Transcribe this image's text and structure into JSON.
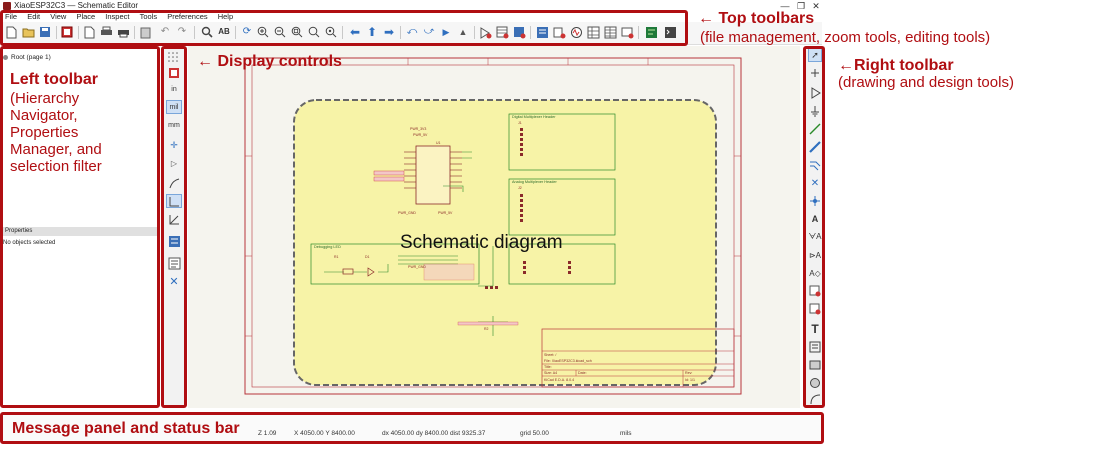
{
  "window": {
    "title": "XiaoESP32C3 — Schematic Editor",
    "controls": [
      "—",
      "❐",
      "✕"
    ]
  },
  "menu": [
    "File",
    "Edit",
    "View",
    "Place",
    "Inspect",
    "Tools",
    "Preferences",
    "Help"
  ],
  "hierarchy": {
    "root_label": "Root (page 1)"
  },
  "properties": {
    "header": "Properties",
    "empty_message": "No objects selected"
  },
  "display_controls": {
    "inch_label": "in",
    "mil_label": "mil",
    "mm_label": "mm"
  },
  "status": {
    "zoom": "Z 1.09",
    "coords": "X 4050.00  Y 8400.00",
    "delta": "dx 4050.00  dy 8400.00  dist 9325.37",
    "grid": "grid 50.00",
    "units": "mils"
  },
  "schematic": {
    "label": "Schematic diagram",
    "block_titles": [
      "Digital Multiplexer Header",
      "Analog Multiplexer Header",
      "Debugging LED"
    ],
    "title_block": {
      "sheet": "Sheet: /",
      "file": "File: XiaoESP32C3.kicad_sch",
      "title": "Title:",
      "size": "Size: A4",
      "date": "Date:",
      "rev": "Rev:",
      "kicad": "KiCad E.D.A. 8.0.4",
      "id": "Id: 1/1"
    }
  },
  "annotations": {
    "top_toolbars_title": "← Top toolbars",
    "top_toolbars_desc": "(file management, zoom tools, editing tools)",
    "display_controls": "← Display controls",
    "left_toolbar_title": "Left toolbar",
    "left_toolbar_desc": [
      "(Hierarchy",
      "Navigator,",
      "Properties",
      "Manager, and",
      "selection filter"
    ],
    "right_toolbar_title": "←Right toolbar",
    "right_toolbar_desc": "(drawing and design tools)",
    "message_panel": "Message panel and status bar"
  },
  "colors": {
    "annotation": "#b00e12",
    "schematic_fill": "#f7f3a7",
    "border_line": "#b8333a",
    "wire": "#2a8a2a"
  }
}
